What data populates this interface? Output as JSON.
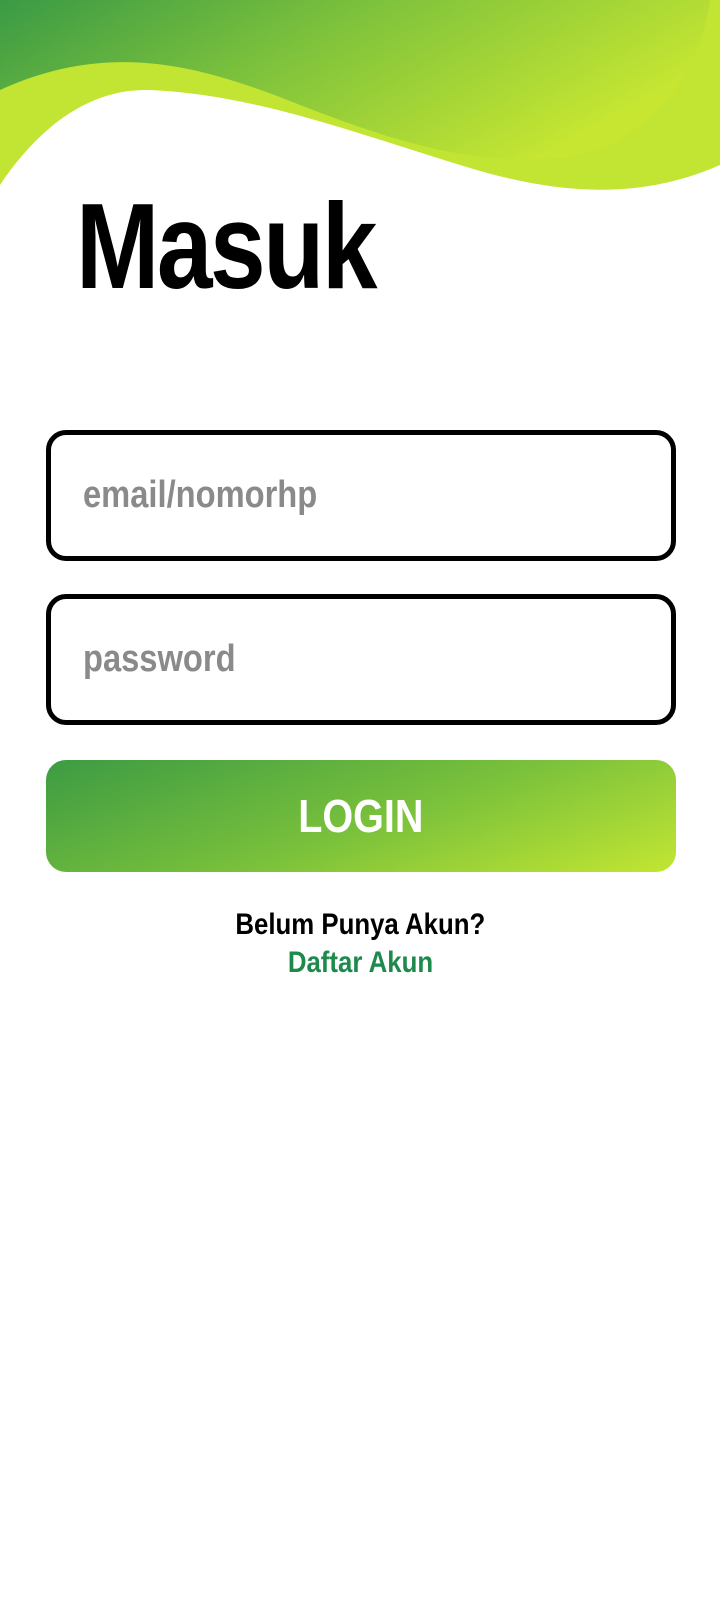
{
  "screen": {
    "title": "Masuk"
  },
  "form": {
    "email": {
      "value": "",
      "placeholder": "email/nomorhp"
    },
    "password": {
      "value": "",
      "placeholder": "password"
    },
    "login_label": "LOGIN"
  },
  "signup": {
    "prompt": "Belum Punya Akun?",
    "link_label": "Daftar Akun"
  },
  "colors": {
    "primary_green_dark": "#3c9b43",
    "primary_green_light": "#c3e632",
    "link_green": "#1d8a4c",
    "placeholder_gray": "#8a8a8a"
  }
}
